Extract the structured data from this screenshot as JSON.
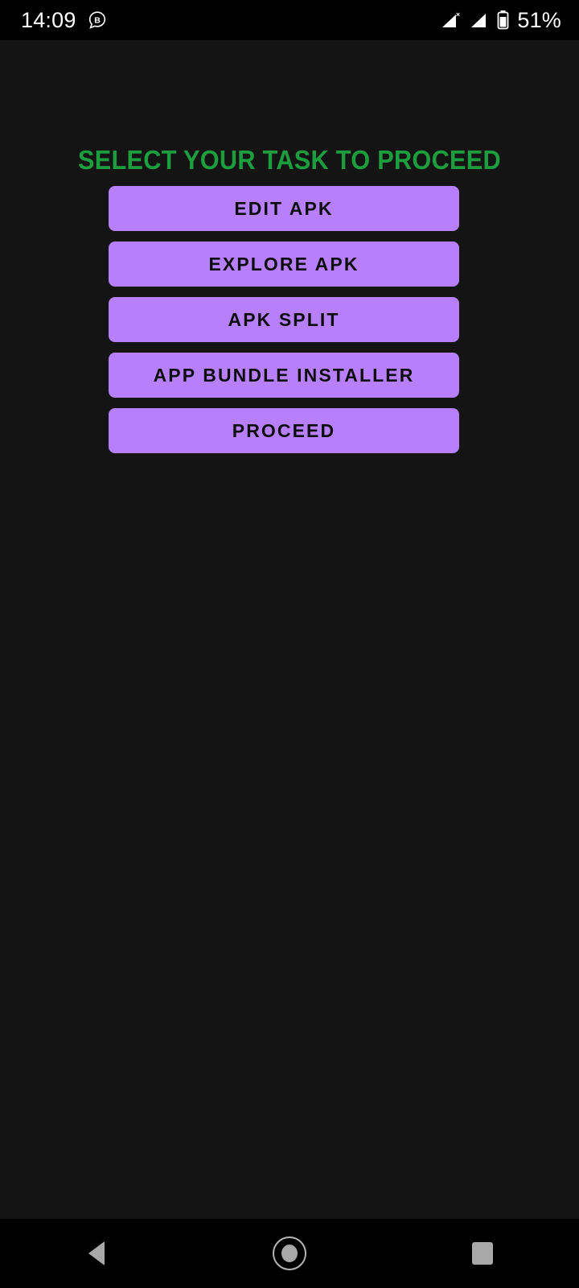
{
  "status_bar": {
    "time": "14:09",
    "notification_icon": "speech-bubble-b-icon",
    "signal_icon_1": "signal-no-sim-icon",
    "signal_icon_2": "signal-bars-icon",
    "battery_icon": "battery-icon",
    "battery_percent": "51%",
    "background_color": "#000000",
    "text_color": "#ffffff"
  },
  "screen": {
    "title": "SELECT YOUR TASK TO PROCEED",
    "title_color": "#1c9e3f",
    "background_color": "#141414",
    "button_color": "#b87ffa",
    "button_text_color": "#0d0d0d"
  },
  "buttons": [
    {
      "label": "EDIT APK"
    },
    {
      "label": "EXPLORE APK"
    },
    {
      "label": "APK SPLIT"
    },
    {
      "label": "APP BUNDLE INSTALLER"
    },
    {
      "label": "PROCEED"
    }
  ],
  "nav_bar": {
    "back_icon": "triangle-back-icon",
    "home_icon": "circle-home-icon",
    "recents_icon": "square-recents-icon",
    "background_color": "#000000"
  }
}
